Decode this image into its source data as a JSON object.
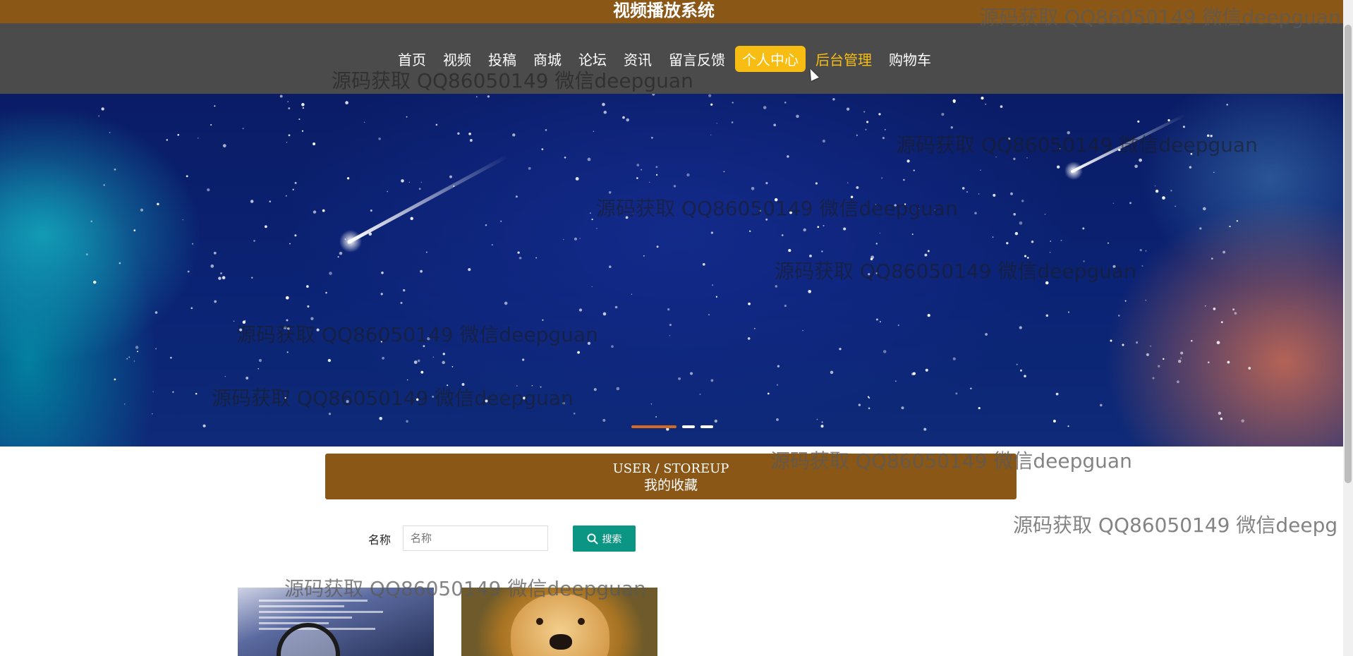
{
  "site": {
    "title": "视频播放系统"
  },
  "nav": {
    "items": [
      {
        "label": "首页"
      },
      {
        "label": "视频"
      },
      {
        "label": "投稿"
      },
      {
        "label": "商城"
      },
      {
        "label": "论坛"
      },
      {
        "label": "资讯"
      },
      {
        "label": "留言反馈"
      },
      {
        "label": "个人中心",
        "active": true
      },
      {
        "label": "后台管理",
        "highlight": true
      },
      {
        "label": "购物车"
      }
    ]
  },
  "colors": {
    "topbar": "#8a5716",
    "navbar": "#4b4b4b",
    "active_tab": "#f7bd12",
    "search_button": "#0b9683"
  },
  "banner": {
    "carousel_dots": 3,
    "active_dot": 1
  },
  "section": {
    "title_en": "USER / STOREUP",
    "title_zh": "我的收藏"
  },
  "search": {
    "label": "名称",
    "placeholder": "名称",
    "value": "",
    "button_label": "搜索",
    "button_icon": "search-icon"
  },
  "cards": [
    {
      "image": "code-magnifier-image"
    },
    {
      "image": "golden-dog-image"
    }
  ],
  "watermark": {
    "text": "源码获取 QQ86050149 微信deepguan",
    "partial_text_1": "源码获取 QQ86050149 微信deepguan",
    "partial_text_2": "源码获取 QQ86050149 微信deepg"
  }
}
